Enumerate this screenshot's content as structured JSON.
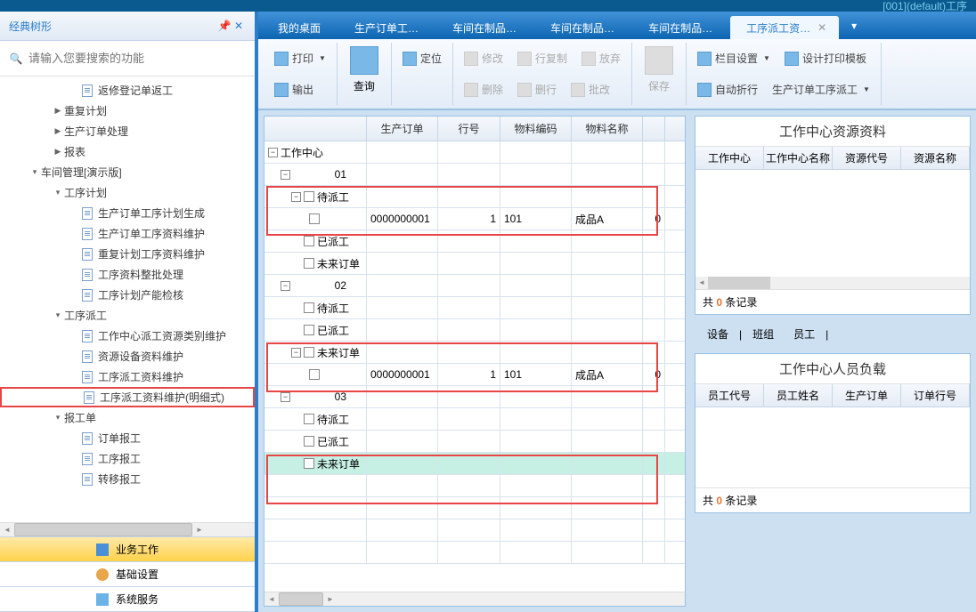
{
  "titleBar": "[001](default)工序",
  "sidebar": {
    "title": "经典树形",
    "searchPlaceholder": "请输入您要搜索的功能",
    "items": [
      {
        "indent": 90,
        "icon": "doc",
        "label": "返修登记单返工"
      },
      {
        "indent": 58,
        "toggle": "▶",
        "label": "重复计划"
      },
      {
        "indent": 58,
        "toggle": "▶",
        "label": "生产订单处理"
      },
      {
        "indent": 58,
        "toggle": "▶",
        "label": "报表"
      },
      {
        "indent": 32,
        "toggle": "▾",
        "label": "车间管理[演示版]"
      },
      {
        "indent": 58,
        "toggle": "▾",
        "label": "工序计划"
      },
      {
        "indent": 90,
        "icon": "doc",
        "label": "生产订单工序计划生成"
      },
      {
        "indent": 90,
        "icon": "doc",
        "label": "生产订单工序资料维护"
      },
      {
        "indent": 90,
        "icon": "doc",
        "label": "重复计划工序资料维护"
      },
      {
        "indent": 90,
        "icon": "doc",
        "label": "工序资料整批处理"
      },
      {
        "indent": 90,
        "icon": "doc",
        "label": "工序计划产能检核"
      },
      {
        "indent": 58,
        "toggle": "▾",
        "label": "工序派工"
      },
      {
        "indent": 90,
        "icon": "doc",
        "label": "工作中心派工资源类别维护"
      },
      {
        "indent": 90,
        "icon": "doc",
        "label": "资源设备资料维护"
      },
      {
        "indent": 90,
        "icon": "doc",
        "label": "工序派工资料维护"
      },
      {
        "indent": 90,
        "icon": "doc",
        "label": "工序派工资料维护(明细式)",
        "highlighted": true
      },
      {
        "indent": 58,
        "toggle": "▾",
        "label": "报工单"
      },
      {
        "indent": 90,
        "icon": "doc",
        "label": "订单报工"
      },
      {
        "indent": 90,
        "icon": "doc",
        "label": "工序报工"
      },
      {
        "indent": 90,
        "icon": "doc",
        "label": "转移报工"
      }
    ],
    "bottomTabs": {
      "biz": "业务工作",
      "cfg": "基础设置",
      "svc": "系统服务"
    }
  },
  "tabs": [
    {
      "label": "我的桌面"
    },
    {
      "label": "生产订单工…"
    },
    {
      "label": "车间在制品…"
    },
    {
      "label": "车间在制品…"
    },
    {
      "label": "车间在制品…"
    },
    {
      "label": "工序派工资…",
      "active": true
    }
  ],
  "toolbar": {
    "print": "打印",
    "export": "输出",
    "query": "查询",
    "locate": "定位",
    "edit": "修改",
    "delete": "删除",
    "copy": "行复制",
    "rowdel": "删行",
    "abandon": "放弃",
    "batch": "批改",
    "save": "保存",
    "colset": "栏目设置",
    "wrap": "自动折行",
    "printtpl": "设计打印模板",
    "dispatch": "生产订单工序派工"
  },
  "grid": {
    "headers": [
      "生产订单",
      "行号",
      "物料编码",
      "物料名称",
      ""
    ],
    "root": "工作中心",
    "nodes": {
      "n01": "01",
      "wait": "待派工",
      "done": "已派工",
      "future": "未来订单",
      "n02": "02",
      "n03": "03"
    },
    "row1": {
      "order": "0000000001",
      "line": "1",
      "mat": "101",
      "name": "成品A",
      "q": "0"
    },
    "row2": {
      "order": "0000000001",
      "line": "1",
      "mat": "101",
      "name": "成品A",
      "q": "0"
    }
  },
  "rightTop": {
    "title": "工作中心资源资料",
    "headers": [
      "工作中心",
      "工作中心名称",
      "资源代号",
      "资源名称"
    ],
    "footer_pre": "共 ",
    "footer_cnt": "0",
    "footer_suf": " 条记录"
  },
  "subTabs": {
    "dev": "设备",
    "team": "班组",
    "emp": "员工"
  },
  "rightBot": {
    "title": "工作中心人员负载",
    "headers": [
      "员工代号",
      "员工姓名",
      "生产订单",
      "订单行号"
    ],
    "footer_pre": "共 ",
    "footer_cnt": "0",
    "footer_suf": " 条记录"
  }
}
